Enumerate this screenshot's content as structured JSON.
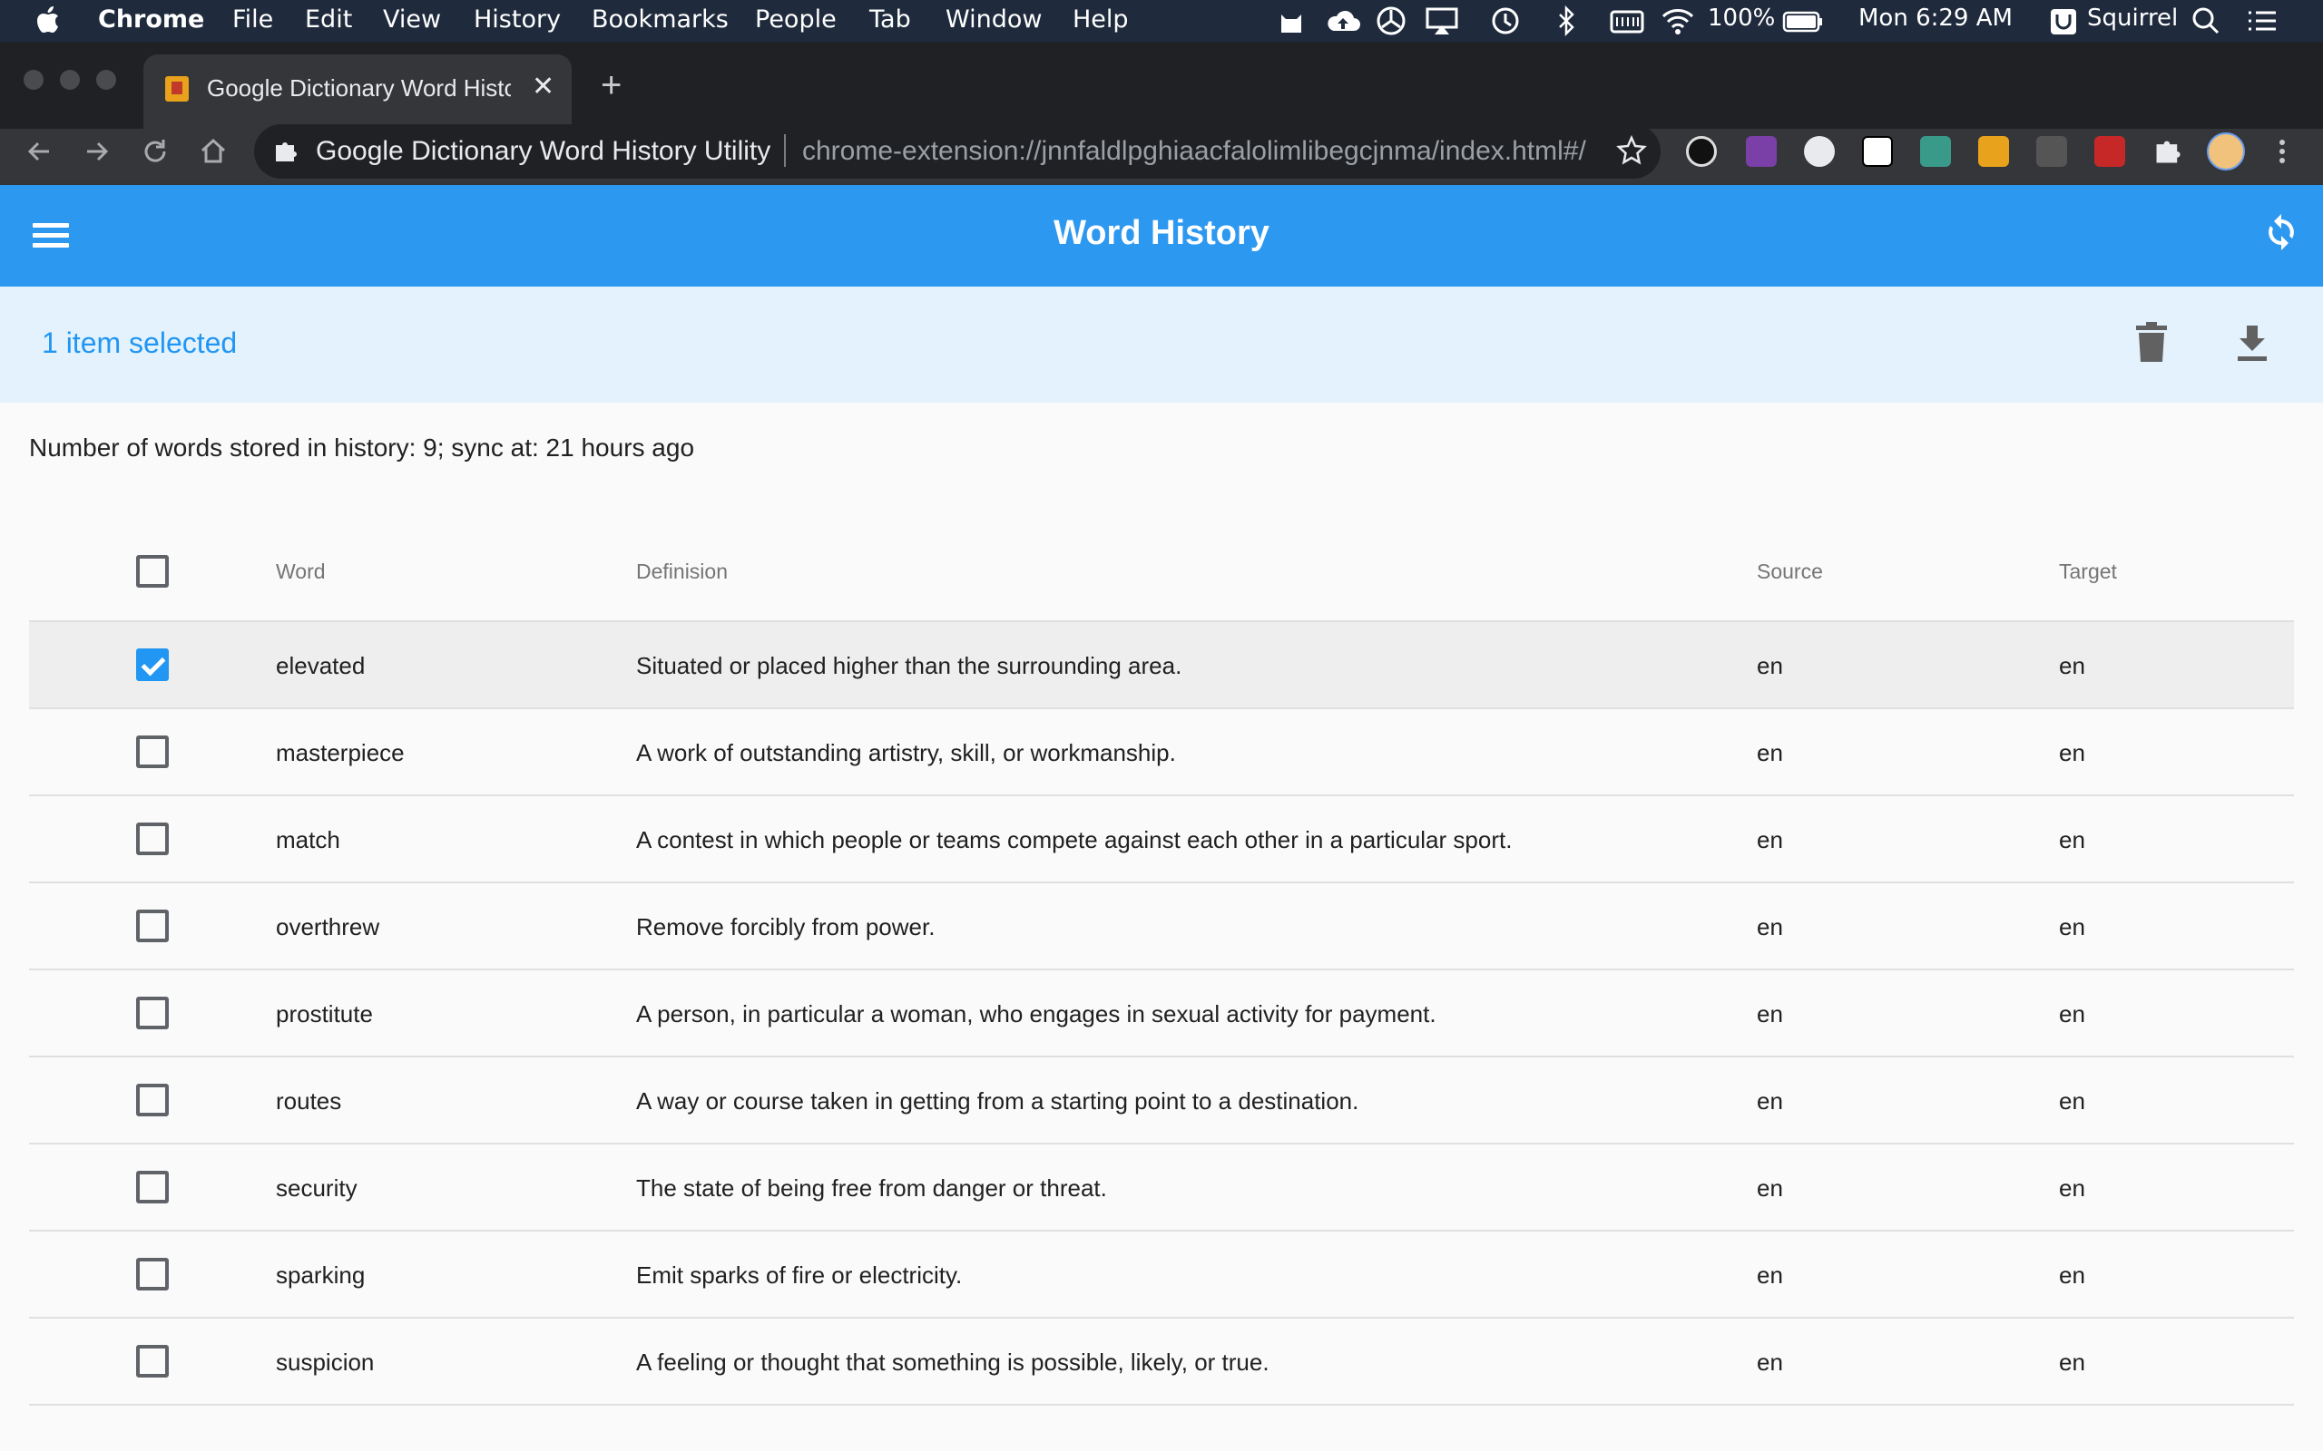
{
  "menubar": {
    "apple": "",
    "app": "Chrome",
    "items": [
      "File",
      "Edit",
      "View",
      "History",
      "Bookmarks",
      "People",
      "Tab",
      "Window",
      "Help"
    ],
    "battery": "100%",
    "clock": "Mon 6:29 AM",
    "user": "Squirrel"
  },
  "browser": {
    "tab_title": "Google Dictionary Word History",
    "tab_close": "✕",
    "new_tab": "+",
    "site_name": "Google Dictionary Word History Utility",
    "url": "chrome-extension://jnnfaldlpghiaacfalolimlibegcjnma/index.html#/"
  },
  "app": {
    "title": "Word History",
    "selection_text": "1 item selected",
    "summary": "Number of words stored in history: 9; sync at: 21 hours ago"
  },
  "table": {
    "columns": {
      "word": "Word",
      "definition": "Definision",
      "source": "Source",
      "target": "Target"
    },
    "rows": [
      {
        "word": "elevated",
        "definition": "Situated or placed higher than the surrounding area.",
        "source": "en",
        "target": "en",
        "checked": true
      },
      {
        "word": "masterpiece",
        "definition": "A work of outstanding artistry, skill, or workmanship.",
        "source": "en",
        "target": "en",
        "checked": false
      },
      {
        "word": "match",
        "definition": "A contest in which people or teams compete against each other in a particular sport.",
        "source": "en",
        "target": "en",
        "checked": false
      },
      {
        "word": "overthrew",
        "definition": "Remove forcibly from power.",
        "source": "en",
        "target": "en",
        "checked": false
      },
      {
        "word": "prostitute",
        "definition": "A person, in particular a woman, who engages in sexual activity for payment.",
        "source": "en",
        "target": "en",
        "checked": false
      },
      {
        "word": "routes",
        "definition": "A way or course taken in getting from a starting point to a destination.",
        "source": "en",
        "target": "en",
        "checked": false
      },
      {
        "word": "security",
        "definition": "The state of being free from danger or threat.",
        "source": "en",
        "target": "en",
        "checked": false
      },
      {
        "word": "sparking",
        "definition": "Emit sparks of fire or electricity.",
        "source": "en",
        "target": "en",
        "checked": false
      },
      {
        "word": "suspicion",
        "definition": "A feeling or thought that something is possible, likely, or true.",
        "source": "en",
        "target": "en",
        "checked": false
      }
    ]
  },
  "colors": {
    "primary": "#2d98f0",
    "selection_bg": "#e3f2fd",
    "accent": "#2196f3"
  }
}
